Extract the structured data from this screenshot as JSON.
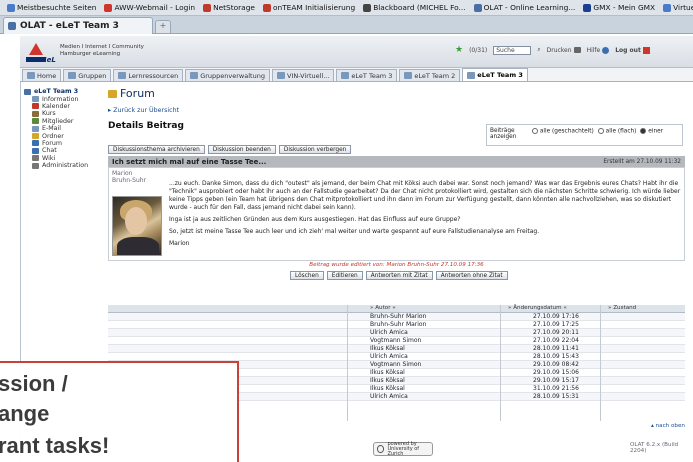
{
  "bookmarks": [
    {
      "label": "Meistbesuchte Seiten",
      "color": "#4a7bc8"
    },
    {
      "label": "AWW-Webmail - Login",
      "color": "#d0342c"
    },
    {
      "label": "NetStorage",
      "color": "#c0392b"
    },
    {
      "label": "onTEAM Initialisierung",
      "color": "#c0392b"
    },
    {
      "label": "Blackboard (MICHEL Fo...",
      "color": "#444444"
    },
    {
      "label": "OLAT - Online Learning...",
      "color": "#4a6fa5"
    },
    {
      "label": "GMX - Mein GMX",
      "color": "#1c3f94"
    },
    {
      "label": "Virtuelle Teamarbeit",
      "color": "#4a7bc8"
    }
  ],
  "browser_tab": {
    "title": "OLAT - eLeT Team 3",
    "new_tab": "+"
  },
  "header": {
    "logo": "MICHeL",
    "logo_sub1": "Medien I Internet I Community",
    "logo_sub2": "Hamburger eLearning",
    "status": "(0/31)",
    "search_value": "Suche",
    "print": "Drucken",
    "help": "Hilfe",
    "logout": "Log out"
  },
  "nav_tabs": [
    {
      "label": "Home",
      "active": false
    },
    {
      "label": "Gruppen",
      "active": false
    },
    {
      "label": "Lernressourcen",
      "active": false
    },
    {
      "label": "Gruppenverwaltung",
      "active": false
    },
    {
      "label": "VIN-Virtuell...",
      "active": false
    },
    {
      "label": "eLeT Team 3",
      "active": false
    },
    {
      "label": "eLeT Team 2",
      "active": false
    },
    {
      "label": "eLeT Team 3",
      "active": true
    }
  ],
  "menu": [
    {
      "label": "eLeT Team 3",
      "root": true,
      "color": "#4a6fa5"
    },
    {
      "label": "Information",
      "root": false,
      "color": "#7a98bb"
    },
    {
      "label": "Kalender",
      "root": false,
      "color": "#c0392b"
    },
    {
      "label": "Kurs",
      "root": false,
      "color": "#8a6d3b"
    },
    {
      "label": "Mitglieder",
      "root": false,
      "color": "#5b8a3a"
    },
    {
      "label": "E-Mail",
      "root": false,
      "color": "#7a98bb"
    },
    {
      "label": "Ordner",
      "root": false,
      "color": "#d6a62a"
    },
    {
      "label": "Forum",
      "root": false,
      "color": "#3a6fb0"
    },
    {
      "label": "Chat",
      "root": false,
      "color": "#3a6fb0"
    },
    {
      "label": "Wiki",
      "root": false,
      "color": "#777777"
    },
    {
      "label": "Administration",
      "root": false,
      "color": "#777777"
    }
  ],
  "forum": {
    "title": "Forum",
    "back": "Zurück zur Übersicht",
    "detail_title": "Details Beitrag",
    "display_label": "Beiträge anzeigen",
    "display_opts": [
      "alle (geschachtelt)",
      "alle (flach)",
      "einer"
    ],
    "buttons": [
      "Diskussionsthema archivieren",
      "Diskussion beenden",
      "Diskussion verbergen"
    ]
  },
  "post": {
    "title": "Ich setzt mich mal auf eine Tasse Tee...",
    "date": "Erstellt am 27.10.09 11:32",
    "author_line1": "Marion",
    "author_line2": "Bruhn-Suhr",
    "para1": "...zu euch. Danke Simon, dass du dich \"outest\" als jemand, der beim Chat mit Köksi auch dabei war. Sonst noch jemand? Was war das Ergebnis eures Chats? Habt ihr die \"Technik\" ausprobiert oder habt ihr auch an der Fallstudie gearbeitet? Da der Chat nicht protokolliert wird, gestalten sich die nächsten Schritte schwierig. Ich würde lieber keine Tipps geben (ein Team hat übrigens den Chat mitprotokolliert und ihn dann im Forum zur Verfügung gestellt, dann könnten alle nachvollziehen, was so diskutiert wurde - auch für den Fall, dass jemand nicht dabei sein kann).",
    "para2": "Inga ist ja aus zeitlichen Gründen aus dem Kurs ausgestiegen. Hat das Einfluss auf eure Gruppe?",
    "para3": "So, jetzt ist meine Tasse Tee auch leer und ich zieh' mal weiter und warte gespannt auf eure Fallstudienanalyse am Freitag.",
    "sign": "Marion",
    "edited": "Beitrag wurde editiert von: Marion Bruhn-Suhr 27.10.09 17:36",
    "actions": [
      "Löschen",
      "Editieren",
      "Antworten mit Zitat",
      "Antworten ohne Zitat"
    ]
  },
  "table": {
    "headers": [
      "Autor",
      "Änderungsdatum",
      "Zustand"
    ],
    "rows": [
      {
        "author": "Bruhn-Suhr Marion",
        "date": "27.10.09 17:16"
      },
      {
        "author": "Bruhn-Suhr Marion",
        "date": "27.10.09 17:25"
      },
      {
        "author": "Ulrich Amica",
        "date": "27.10.09 20:11"
      },
      {
        "author": "Vogtmann Simon",
        "date": "27.10.09 22:04"
      },
      {
        "author": "Ilkus Köksal",
        "date": "28.10.09 11:41"
      },
      {
        "author": "Ulrich Amica",
        "date": "28.10.09 15:43"
      },
      {
        "author": "Vogtmann Simon",
        "date": "29.10.09 08:42"
      },
      {
        "author": "Ilkus Köksal",
        "date": "29.10.09 15:06"
      },
      {
        "author": "Ilkus Köksal",
        "date": "29.10.09 15:17"
      },
      {
        "author": "Ilkus Köksal",
        "date": "31.10.09 21:56"
      },
      {
        "author": "Ulrich Amica",
        "date": "28.10.09 15:31"
      }
    ]
  },
  "footer": {
    "top_link": "nach oben",
    "uzh1": "powered by",
    "uzh2": "University of Zurich",
    "version": "OLAT 6.2.x (Build 2204)"
  },
  "overlay": {
    "line1": "ssion /",
    "line2": "ange",
    "line3": "rant tasks!"
  }
}
